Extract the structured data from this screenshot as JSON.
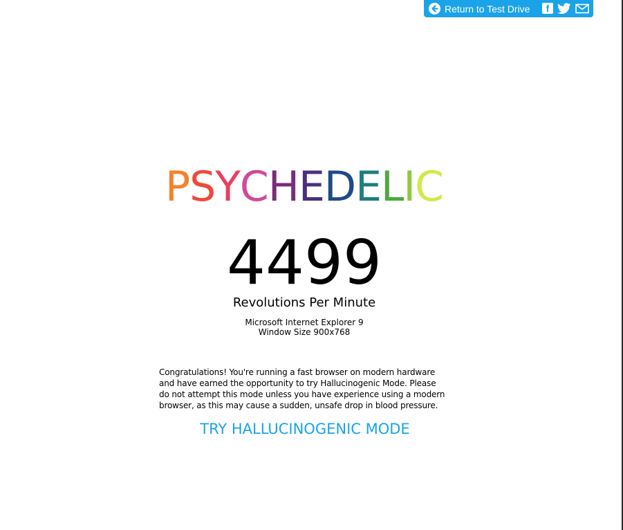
{
  "header": {
    "return_label": "Return to Test Drive",
    "accent_color": "#1aa3e8",
    "icons": [
      "back-arrow-icon",
      "facebook-icon",
      "twitter-icon",
      "email-icon"
    ]
  },
  "title": {
    "letters": [
      {
        "char": "P",
        "color": "#f5822a"
      },
      {
        "char": "S",
        "color": "#ee4a3a"
      },
      {
        "char": "Y",
        "color": "#ea3f62"
      },
      {
        "char": "C",
        "color": "#d1499a"
      },
      {
        "char": "H",
        "color": "#7b2c7a"
      },
      {
        "char": "E",
        "color": "#4c2f7e"
      },
      {
        "char": "D",
        "color": "#1f4a8a"
      },
      {
        "char": "E",
        "color": "#1f7e80"
      },
      {
        "char": "L",
        "color": "#4caa3c"
      },
      {
        "char": "I",
        "color": "#8fca3e"
      },
      {
        "char": "C",
        "color": "#d3e94a"
      }
    ]
  },
  "stats": {
    "rpm_value": "4499",
    "rpm_label": "Revolutions Per Minute",
    "browser": "Microsoft Internet Explorer 9",
    "window_size": "Window Size 900x768"
  },
  "message": {
    "lines": [
      "Congratulations! You're running a fast browser on modern hardware",
      "and have earned the opportunity to try Hallucinogenic Mode. Please",
      "do not attempt this mode unless you have experience using a modern",
      "browser, as this may cause a sudden, unsafe drop in blood pressure."
    ]
  },
  "cta": {
    "label": "TRY HALLUCINOGENIC MODE",
    "color": "#1aa3e8"
  }
}
